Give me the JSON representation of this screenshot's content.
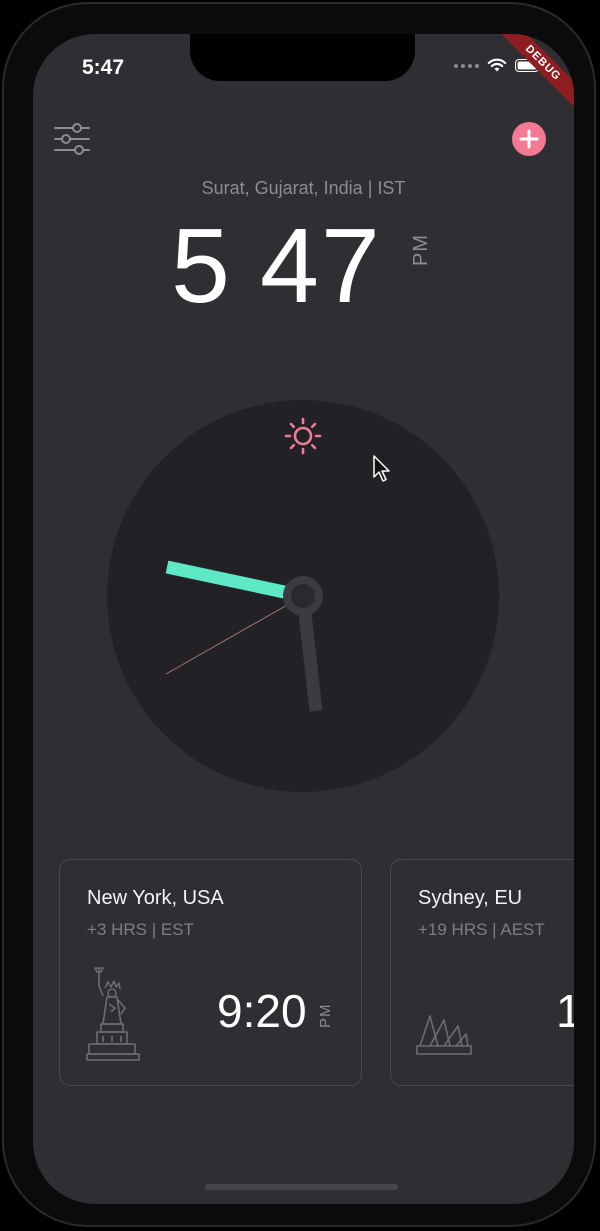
{
  "status_bar": {
    "time": "5:47",
    "debug_label": "DEBUG"
  },
  "header": {
    "location": "Surat, Gujarat, India | IST"
  },
  "main_clock": {
    "hour": "5",
    "minute": "47",
    "period": "PM"
  },
  "cards": [
    {
      "city": "New York, USA",
      "offset": "+3 HRS | EST",
      "time": "9:20",
      "period": "PM",
      "landmark": "statue-of-liberty-icon"
    },
    {
      "city": "Sydney, EU",
      "offset": "+19 HRS | AEST",
      "time": "1",
      "period": "",
      "landmark": "sydney-opera-house-icon"
    }
  ],
  "colors": {
    "background": "#2f2e33",
    "clock_face": "#222126",
    "accent_pink": "#f27a92",
    "minute_hand": "#5de8c6",
    "hour_hand": "#3c3b40",
    "second_hand": "#a8736f"
  }
}
